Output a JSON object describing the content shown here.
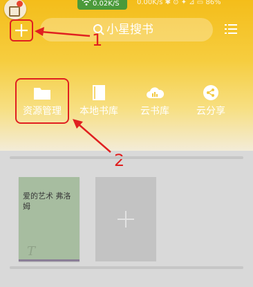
{
  "status_bar": {
    "net_speed": "0.02K/S",
    "right_text": "0.00K/s ✱ ⊙ ✦ ⊿ ▭ 86%"
  },
  "search": {
    "placeholder": "小星搜书"
  },
  "shortcuts": [
    {
      "label": "资源管理",
      "icon": "folder-icon"
    },
    {
      "label": "本地书库",
      "icon": "book-icon"
    },
    {
      "label": "云书库",
      "icon": "cloud-icon"
    },
    {
      "label": "云分享",
      "icon": "share-icon"
    }
  ],
  "annotations": {
    "one": "1",
    "two": "2"
  },
  "shelf": {
    "books": [
      {
        "title": "爱的艺术 弗洛姆",
        "cover_mark": "T"
      }
    ],
    "add_book_icon": "plus-icon"
  },
  "colors": {
    "accent": "#f4bd1a",
    "annotation": "#e02020",
    "book_cover": "#a7bda0"
  }
}
